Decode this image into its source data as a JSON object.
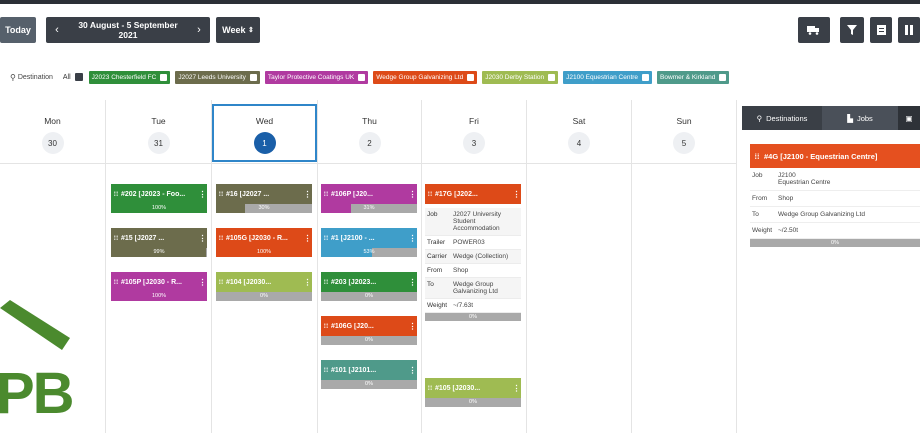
{
  "toolbar": {
    "today_label": "Today",
    "prev_icon": "‹",
    "range_label": "30 August - 5 September 2021",
    "next_icon": "›",
    "view_label": "Week",
    "view_caret": "⇕"
  },
  "filters": {
    "destination_label": "Destination",
    "all_label": "All",
    "tags": [
      {
        "label": "J2023 Chesterfield FC",
        "color": "#2f8f3a"
      },
      {
        "label": "J2027 Leeds University",
        "color": "#6c6c4c"
      },
      {
        "label": "Taylor Protective Coatings UK",
        "color": "#b03aa0"
      },
      {
        "label": "Wedge Group Galvanizing Ltd",
        "color": "#dd4a18"
      },
      {
        "label": "J2030 Derby Station",
        "color": "#9fbb52"
      },
      {
        "label": "J2100 Equestrian Centre",
        "color": "#3f9ec9"
      },
      {
        "label": "Bowmer & Kirkland",
        "color": "#4f9a8a"
      }
    ]
  },
  "days": [
    {
      "name": "Mon",
      "num": "30"
    },
    {
      "name": "Tue",
      "num": "31"
    },
    {
      "name": "Wed",
      "num": "1"
    },
    {
      "name": "Thu",
      "num": "2"
    },
    {
      "name": "Fri",
      "num": "3"
    },
    {
      "name": "Sat",
      "num": "4"
    },
    {
      "name": "Sun",
      "num": "5"
    }
  ],
  "cards": {
    "c202": {
      "title": "#202 [J2023 - Foo...",
      "pct": "100%",
      "progress": 1.0,
      "color": "#2f8f3a"
    },
    "c15": {
      "title": "#15 [J2027 ...",
      "pct": "99%",
      "progress": 0.99,
      "color": "#6c6c4c"
    },
    "c105p": {
      "title": "#105P [J2030 - R...",
      "pct": "100%",
      "progress": 1.0,
      "color": "#b03aa0"
    },
    "c16": {
      "title": "#16 [J2027 ...",
      "pct": "30%",
      "progress": 0.3,
      "color": "#6c6c4c"
    },
    "c105g": {
      "title": "#105G [J2030 - R...",
      "pct": "100%",
      "progress": 1.0,
      "color": "#dd4a18"
    },
    "c104": {
      "title": "#104 [J2030...",
      "pct": "0%",
      "progress": 0,
      "color": "#9fbb52"
    },
    "c106p": {
      "title": "#106P [J20...",
      "pct": "31%",
      "progress": 0.31,
      "color": "#b03aa0"
    },
    "c1": {
      "title": "#1 [J2100 - ...",
      "pct": "53%",
      "progress": 0.53,
      "color": "#3f9ec9"
    },
    "c203": {
      "title": "#203 [J2023...",
      "pct": "0%",
      "progress": 0,
      "color": "#2f8f3a"
    },
    "c106g": {
      "title": "#106G [J20...",
      "pct": "0%",
      "progress": 0,
      "color": "#dd4a18"
    },
    "c101": {
      "title": "#101 [J2101...",
      "pct": "0%",
      "progress": 0,
      "color": "#4f9a8a"
    },
    "c17g": {
      "title": "#17G [J202...",
      "pct": "",
      "progress": 0,
      "color": "#dd4a18"
    },
    "c105": {
      "title": "#105 [J2030...",
      "pct": "0%",
      "progress": 0,
      "color": "#9fbb52"
    }
  },
  "detail17g": {
    "job_k": "Job",
    "job_v": "J2027 University Student Accommodation",
    "trailer_k": "Trailer",
    "trailer_v": "POWER03",
    "carrier_k": "Carrier",
    "carrier_v": "Wedge (Collection)",
    "from_k": "From",
    "from_v": "Shop",
    "to_k": "To",
    "to_v": "Wedge Group Galvanizing Ltd",
    "weight_k": "Weight",
    "weight_v": "~/7.63t",
    "pct": "0%"
  },
  "panel": {
    "tab_destinations": "Destinations",
    "tab_jobs": "Jobs",
    "card_title": "#4G [J2100 - Equestrian Centre]",
    "card_color": "#e5501f",
    "job_k": "Job",
    "job_v1": "J2100",
    "job_v2": "Equestrian Centre",
    "from_k": "From",
    "from_v": "Shop",
    "to_k": "To",
    "to_v": "Wedge Group Galvanizing Ltd",
    "weight_k": "Weight",
    "weight_v": "~/2.50t",
    "pct": "0%"
  },
  "logo_text": "PB"
}
